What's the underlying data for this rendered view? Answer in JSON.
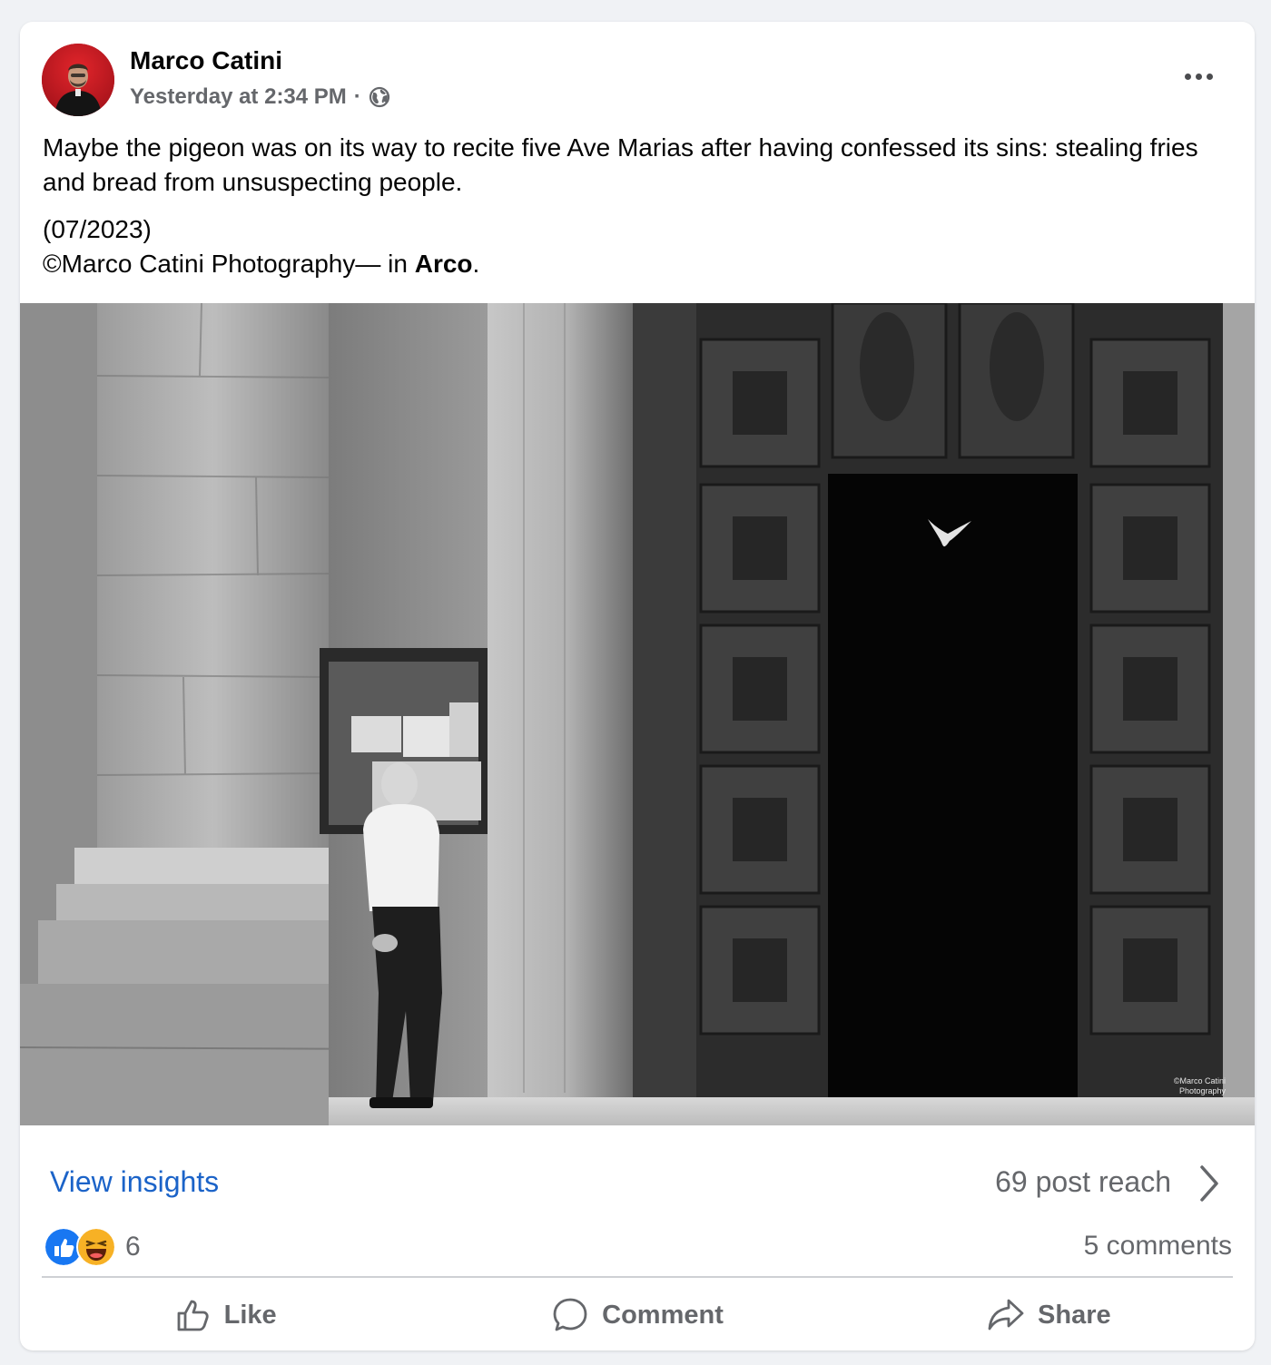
{
  "post": {
    "author": "Marco Catini",
    "timestamp": "Yesterday at 2:34 PM",
    "separator": "·",
    "audience_icon": "globe-icon",
    "more_icon": "more-horizontal-icon",
    "text_line1": "Maybe the pigeon was on its way to recite five Ave Marias after having confessed its sins: stealing fries and bread from unsuspecting people.",
    "text_date": "(07/2023)",
    "credit_prefix": "©Marco Catini Photography— in ",
    "location": "Arco",
    "credit_suffix": ".",
    "photo_watermark_line1": "©Marco Catini",
    "photo_watermark_line2": "Photography"
  },
  "insights": {
    "link_label": "View insights",
    "reach_text": "69 post reach"
  },
  "stats": {
    "reaction_icons": [
      "like-reaction-icon",
      "haha-reaction-icon"
    ],
    "reaction_count": "6",
    "comments_text": "5 comments"
  },
  "actions": {
    "like_label": "Like",
    "comment_label": "Comment",
    "share_label": "Share"
  },
  "colors": {
    "link_blue": "#1b63c8",
    "secondary_text": "#65676b",
    "like_blue": "#1877f2",
    "haha_yellow": "#f7b125"
  }
}
